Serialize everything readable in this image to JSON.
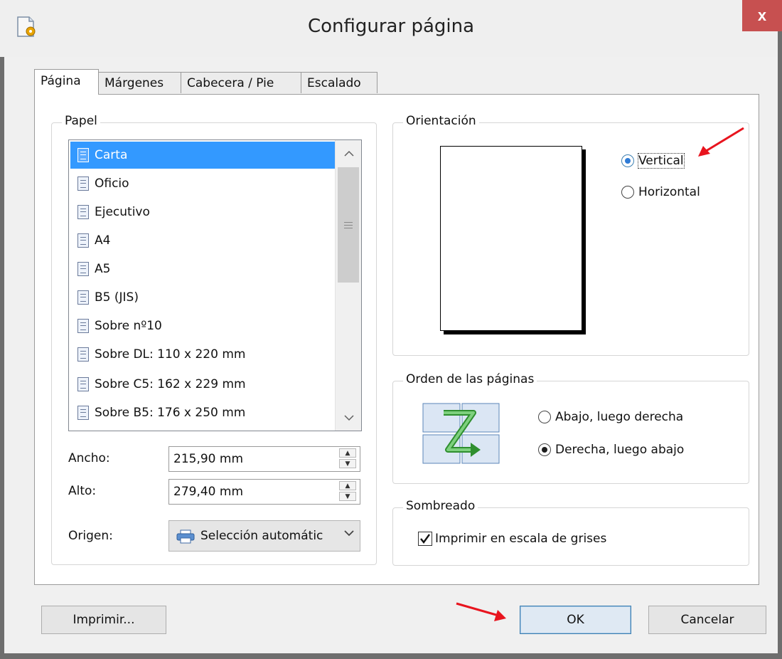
{
  "window": {
    "title": "Configurar página",
    "close_label": "x"
  },
  "tabs": [
    {
      "label": "Página",
      "active": true
    },
    {
      "label": "Márgenes",
      "active": false
    },
    {
      "label": "Cabecera / Pie",
      "active": false
    },
    {
      "label": "Escalado",
      "active": false
    }
  ],
  "paper": {
    "group_label": "Papel",
    "sizes": [
      "Carta",
      "Oficio",
      "Ejecutivo",
      "A4",
      "A5",
      "B5 (JIS)",
      "Sobre nº10",
      "Sobre DL: 110 x 220 mm",
      "Sobre C5: 162 x 229 mm",
      "Sobre B5: 176 x 250 mm"
    ],
    "selected": "Carta",
    "width_label": "Ancho:",
    "width_value": "215,90 mm",
    "height_label": "Alto:",
    "height_value": "279,40 mm",
    "source_label": "Origen:",
    "source_value": "Selección automátic"
  },
  "orientation": {
    "group_label": "Orientación",
    "options": [
      {
        "label": "Vertical",
        "selected": true
      },
      {
        "label": "Horizontal",
        "selected": false
      }
    ]
  },
  "page_order": {
    "group_label": "Orden de las páginas",
    "options": [
      {
        "label": "Abajo, luego derecha",
        "selected": false
      },
      {
        "label": "Derecha, luego abajo",
        "selected": true
      }
    ]
  },
  "shading": {
    "group_label": "Sombreado",
    "grayscale_label": "Imprimir en escala de grises",
    "grayscale_checked": true
  },
  "buttons": {
    "print": "Imprimir...",
    "ok": "OK",
    "cancel": "Cancelar"
  },
  "colors": {
    "selection": "#3399ff",
    "close": "#c75050",
    "annotation_arrow": "#e8141e"
  }
}
